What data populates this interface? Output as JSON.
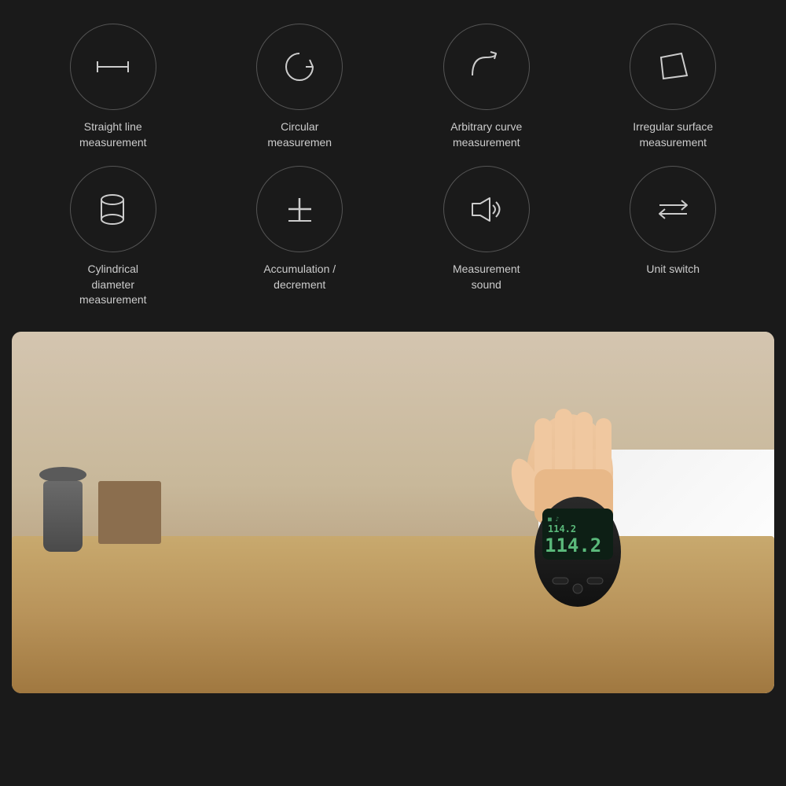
{
  "background": "#1a1a1a",
  "features": {
    "row1": [
      {
        "id": "straight-line",
        "label": "Straight line\nmeasurement",
        "label_line1": "Straight line",
        "label_line2": "measurement",
        "icon_type": "straight-line"
      },
      {
        "id": "circular",
        "label": "Circular\nmeasuremen",
        "label_line1": "Circular",
        "label_line2": "measuremen",
        "icon_type": "circular"
      },
      {
        "id": "arbitrary-curve",
        "label": "Arbitrary curve\nmeasurement",
        "label_line1": "Arbitrary curve",
        "label_line2": "measurement",
        "icon_type": "arbitrary-curve"
      },
      {
        "id": "irregular-surface",
        "label": "Irregular surface\nmeasurement",
        "label_line1": "Irregular surface",
        "label_line2": "measurement",
        "icon_type": "irregular-surface"
      }
    ],
    "row2": [
      {
        "id": "cylindrical",
        "label": "Cylindrical\ndiameter\nmeasurement",
        "label_line1": "Cylindrical",
        "label_line2": "diameter",
        "label_line3": "measurement",
        "icon_type": "cylindrical"
      },
      {
        "id": "accumulation",
        "label": "Accumulation /\ndecrement",
        "label_line1": "Accumulation /",
        "label_line2": "decrement",
        "icon_type": "accumulation"
      },
      {
        "id": "measurement-sound",
        "label": "Measurement\nsound",
        "label_line1": "Measurement",
        "label_line2": "sound",
        "icon_type": "measurement-sound"
      },
      {
        "id": "unit-switch",
        "label": "Unit switch",
        "label_line1": "Unit switch",
        "icon_type": "unit-switch"
      }
    ]
  },
  "device": {
    "screen_value_large": "114.2",
    "screen_value_small": "114.2"
  }
}
